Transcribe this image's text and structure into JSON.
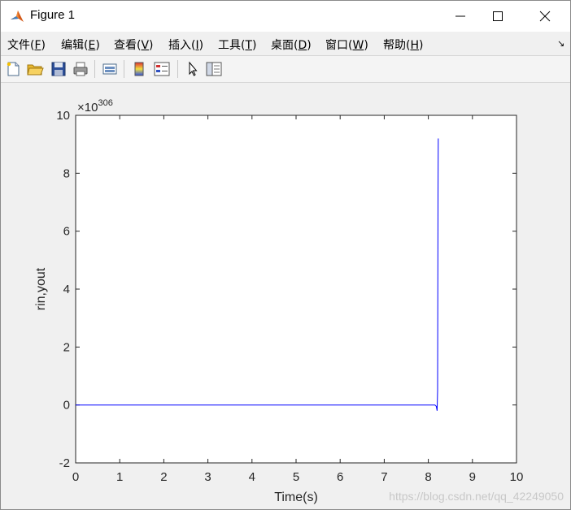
{
  "window": {
    "title": "Figure 1"
  },
  "menu": {
    "items": [
      {
        "label": "文件",
        "key": "F"
      },
      {
        "label": "编辑",
        "key": "E"
      },
      {
        "label": "查看",
        "key": "V"
      },
      {
        "label": "插入",
        "key": "I"
      },
      {
        "label": "工具",
        "key": "T"
      },
      {
        "label": "桌面",
        "key": "D"
      },
      {
        "label": "窗口",
        "key": "W"
      },
      {
        "label": "帮助",
        "key": "H"
      }
    ],
    "dock_glyph": "↘"
  },
  "toolbar": {
    "icons": [
      "new-figure-icon",
      "open-file-icon",
      "save-icon",
      "print-icon",
      "link-plot-icon",
      "colorbar-icon",
      "legend-icon",
      "pointer-icon",
      "property-editor-icon"
    ]
  },
  "watermark": "https://blog.csdn.net/qq_42249050",
  "chart_data": {
    "type": "line",
    "xlabel": "Time(s)",
    "ylabel": "rin,yout",
    "exponent_label": "×10",
    "exponent": "306",
    "xlim": [
      0,
      10
    ],
    "ylim": [
      -2,
      10
    ],
    "xticks": [
      "0",
      "1",
      "2",
      "3",
      "4",
      "5",
      "6",
      "7",
      "8",
      "9",
      "10"
    ],
    "yticks": [
      "-2",
      "0",
      "2",
      "4",
      "6",
      "8",
      "10"
    ],
    "grid": false,
    "series": [
      {
        "color": "#0000ff",
        "x": [
          0,
          1,
          2,
          3,
          4,
          5,
          6,
          7,
          8,
          8.1,
          8.15,
          8.18,
          8.2,
          8.21,
          8.22,
          8.225
        ],
        "y": [
          0,
          0,
          0,
          0,
          0,
          0,
          0,
          0,
          0,
          0,
          0,
          -0.05,
          -0.2,
          0.5,
          7.2,
          9.2
        ]
      }
    ]
  }
}
